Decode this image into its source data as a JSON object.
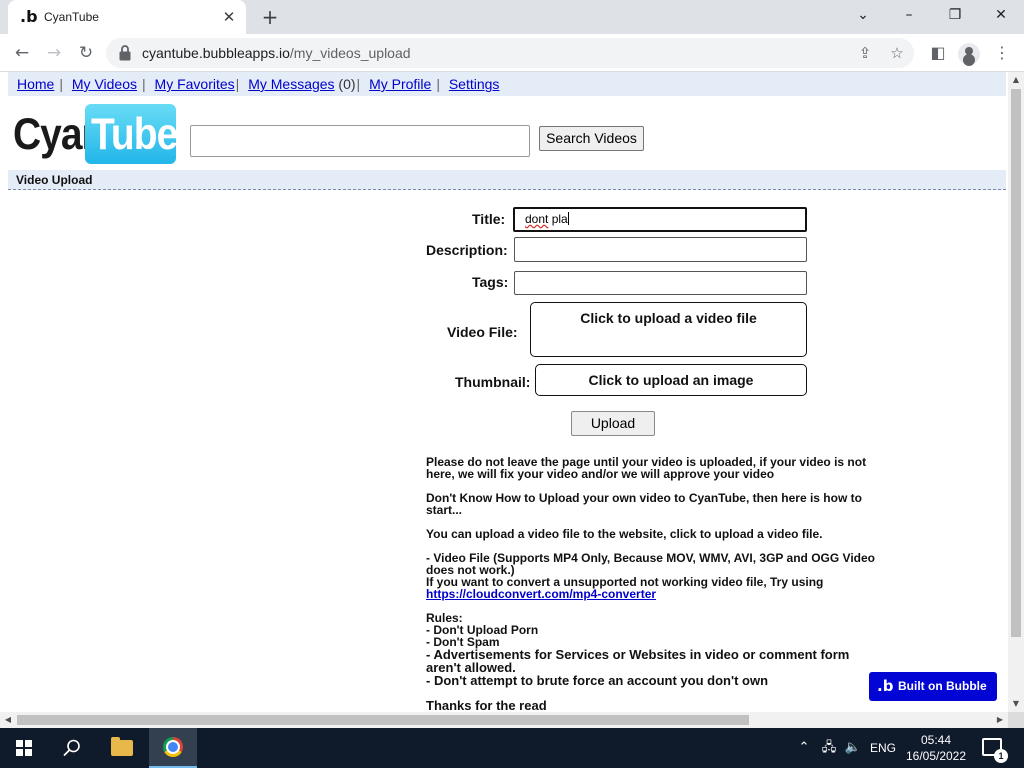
{
  "browser": {
    "tab_title": "CyanTube",
    "url_host": "cyantube.bubbleapps.io",
    "url_path": "/my_videos_upload"
  },
  "site": {
    "nav": [
      {
        "label": "Home"
      },
      {
        "label": "My Videos"
      },
      {
        "label": "My Favorites"
      },
      {
        "label": "My Messages",
        "suffix": " (0)"
      },
      {
        "label": "My Profile"
      },
      {
        "label": "Settings"
      }
    ],
    "logo_left": "Cyan",
    "logo_right": "Tube",
    "search_button": "Search Videos",
    "search_value": "",
    "section_title": "Video Upload"
  },
  "form": {
    "title_label": "Title:",
    "title_value_typo": "dont",
    "title_value_rest": " pla",
    "description_label": "Description:",
    "description_value": "",
    "tags_label": "Tags:",
    "tags_value": "",
    "video_label": "Video File:",
    "video_button": "Click to upload a video file",
    "thumb_label": "Thumbnail:",
    "thumb_button": "Click to upload an image",
    "upload_button": "Upload"
  },
  "info": {
    "p1": "Please do not leave the page until your video is uploaded, if your video is not here, we will fix your video and/or we will approve your video",
    "p2": "Don't Know How to Upload your own video to CyanTube, then here is how to start...",
    "p3": "You can upload a video file to the website, click to upload a video file.",
    "p4a": "- Video File (Supports MP4 Only, Because MOV, WMV, AVI, 3GP and OGG Video does not work.)",
    "p4b": "If you want to convert a unsupported not working video file, Try using ",
    "p4_link": "https://cloudconvert.com/mp4-converter",
    "rules_title": "Rules:",
    "rule1": "- Don't Upload Porn",
    "rule2": "- Don't Spam",
    "rule3": "- Advertisements for Services or Websites in video or comment form aren't allowed.",
    "rule4": "- Don't attempt to brute force an account you don't own",
    "thanks": "Thanks for the read"
  },
  "badge": {
    "label": "Built on Bubble"
  },
  "taskbar": {
    "language": "ENG",
    "time": "05:44",
    "date": "16/05/2022",
    "notification_count": "1"
  },
  "colors": {
    "nav_bg": "#e4ecf7",
    "link": "#0000cc",
    "logo_cyan": "#22b6e9",
    "bubble_badge": "#0205d3",
    "taskbar": "#0f1a2a"
  }
}
